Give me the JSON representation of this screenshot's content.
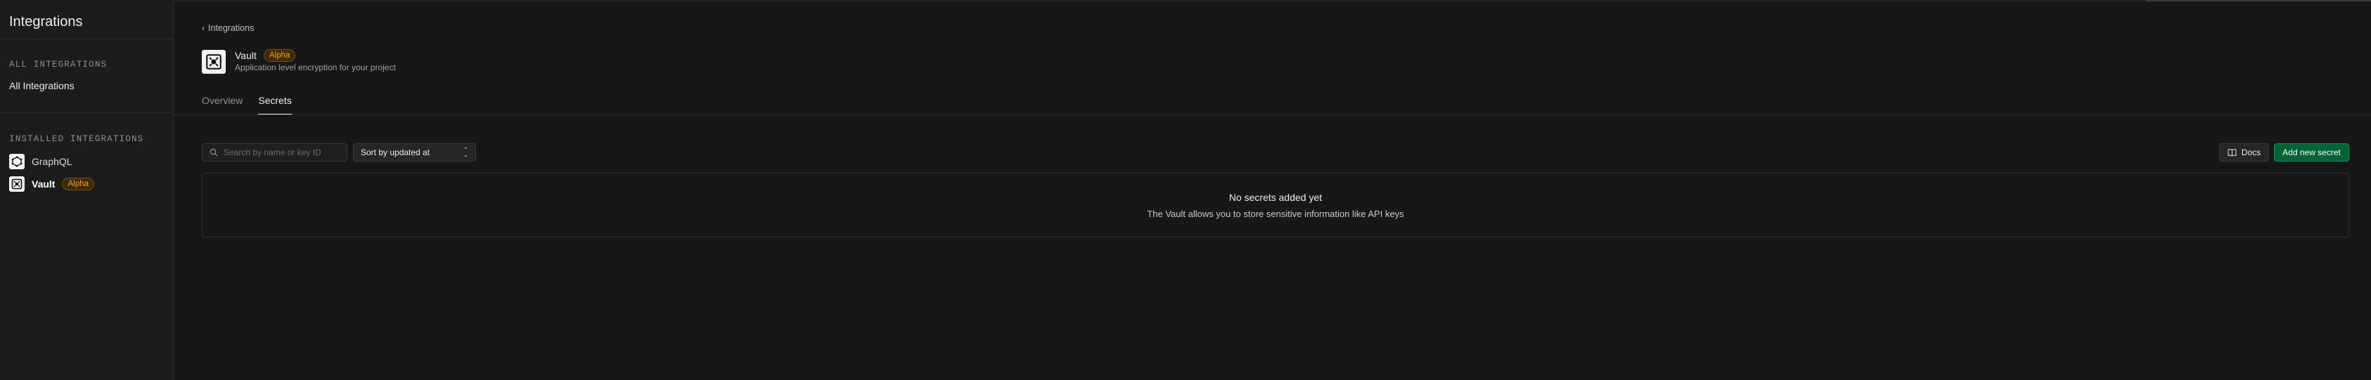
{
  "sidebar": {
    "title": "Integrations",
    "all_section": {
      "label": "All Integrations"
    },
    "all_link": "All Integrations",
    "installed_section": {
      "label": "Installed Integrations"
    },
    "installed": [
      {
        "label": "GraphQL",
        "icon": "graphql-icon"
      },
      {
        "label": "Vault",
        "badge": "Alpha",
        "icon": "vault-icon"
      }
    ]
  },
  "breadcrumb": {
    "label": "Integrations"
  },
  "integration": {
    "name": "Vault",
    "badge": "Alpha",
    "description": "Application level encryption for your project"
  },
  "tabs": [
    {
      "label": "Overview"
    },
    {
      "label": "Secrets",
      "active": true
    }
  ],
  "toolbar": {
    "search_placeholder": "Search by name or key ID",
    "sort_label": "Sort by updated at",
    "docs_label": "Docs",
    "add_label": "Add new secret"
  },
  "empty_state": {
    "title": "No secrets added yet",
    "message": "The Vault allows you to store sensitive information like API keys"
  },
  "colors": {
    "background": "#171717",
    "sidebar": "#1c1c1c",
    "accent_green": "#006239",
    "badge_text": "#f1a10d"
  }
}
